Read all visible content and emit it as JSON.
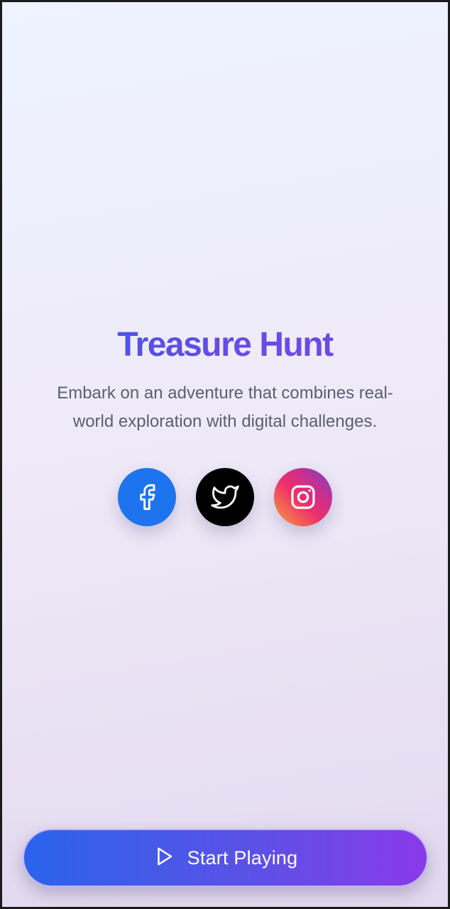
{
  "app": {
    "title": "Treasure Hunt",
    "description": "Embark on an adventure that combines real-world exploration with digital challenges."
  },
  "social": [
    {
      "name": "facebook",
      "icon": "facebook-icon",
      "color": "#1d74ee"
    },
    {
      "name": "twitter",
      "icon": "twitter-icon",
      "color": "#000000"
    },
    {
      "name": "instagram",
      "icon": "instagram-icon",
      "color": "#e1306c"
    }
  ],
  "cta": {
    "label": "Start Playing",
    "icon": "play-icon"
  },
  "colors": {
    "title_gradient_start": "#3f55e6",
    "title_gradient_end": "#7a45e8",
    "button_gradient_start": "#2a63ec",
    "button_gradient_end": "#8a3ae8"
  }
}
